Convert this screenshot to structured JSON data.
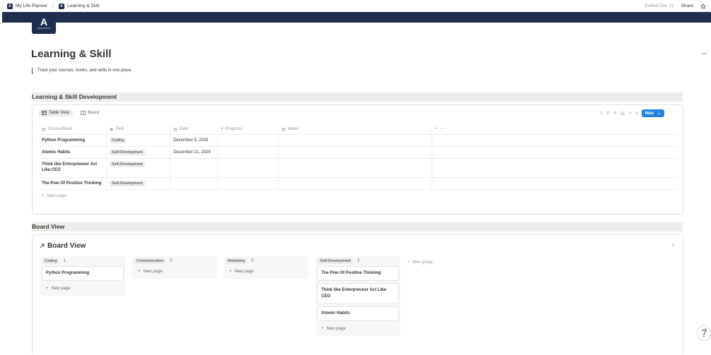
{
  "topbar": {
    "breadcrumbs": [
      {
        "icon": "A",
        "label": "My Life Planner"
      },
      {
        "icon": "A",
        "label": "Learning & Skill"
      }
    ],
    "edited": "Edited Dec 21",
    "share": "Share"
  },
  "logo": {
    "letter": "A",
    "text": "ANALOYTH"
  },
  "page": {
    "title": "Learning & Skill",
    "quote": "Track your courses, books, and skills in one place."
  },
  "sections": {
    "table_section": "Learning & Skill Development",
    "board_section": "Board View"
  },
  "table_view": {
    "tabs": [
      "Table View",
      "Board"
    ],
    "new_button": "New",
    "columns": [
      "Course/Book",
      "Skill",
      "Date",
      "Progress",
      "Notes"
    ],
    "rows": [
      {
        "name": "Python Programming",
        "skill": "Coding",
        "date": "December 8, 2025"
      },
      {
        "name": "Atomic Habits",
        "skill": "Self-Development",
        "date": "December 21, 2025"
      },
      {
        "name": "Think like Enterpreuner Act Like CEO",
        "skill": "Self-Development",
        "date": ""
      },
      {
        "name": "The Pow Of Positive Thinking",
        "skill": "Self-Development",
        "date": ""
      }
    ],
    "new_page": "New page"
  },
  "board_view": {
    "title": "Board View",
    "groups": [
      {
        "name": "Coding",
        "count": "1",
        "cards": [
          "Python Programming"
        ]
      },
      {
        "name": "Communication",
        "count": "0",
        "cards": []
      },
      {
        "name": "Marketing",
        "count": "0",
        "cards": []
      },
      {
        "name": "Self-Development",
        "count": "3",
        "cards": [
          "The Pow Of Positive Thinking",
          "Think like Enterpreuner Act Like CEO",
          "Atomic Habits"
        ]
      }
    ],
    "new_page": "New page",
    "new_group": "New group"
  },
  "colors": {
    "brand": "#1f2d4f",
    "accent": "#2383e2",
    "section_bg": "#ededec"
  }
}
